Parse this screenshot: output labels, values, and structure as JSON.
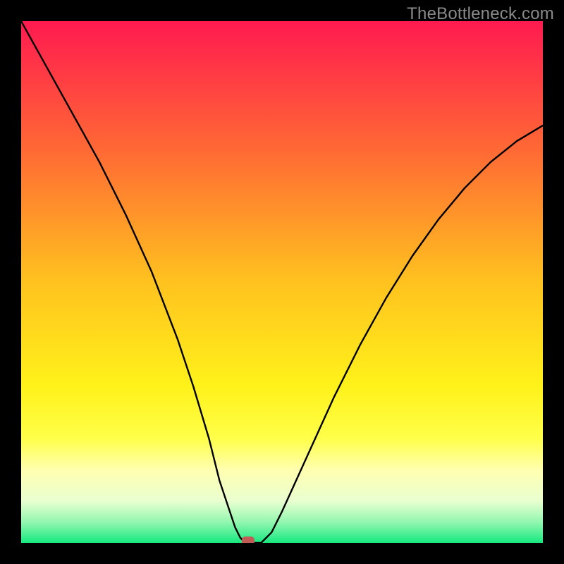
{
  "watermark": "TheBottleneck.com",
  "chart_data": {
    "type": "line",
    "title": "",
    "xlabel": "",
    "ylabel": "",
    "xlim": [
      0,
      100
    ],
    "ylim": [
      0,
      100
    ],
    "grid": false,
    "legend": false,
    "series": [
      {
        "name": "curve",
        "color": "#000000",
        "x": [
          0,
          5,
          10,
          15,
          20,
          25,
          30,
          33,
          36,
          38,
          40,
          41,
          42,
          43,
          44,
          46,
          48,
          50,
          55,
          60,
          65,
          70,
          75,
          80,
          85,
          90,
          95,
          100
        ],
        "values": [
          100,
          91,
          82,
          73,
          63,
          52,
          39,
          30,
          20,
          12,
          6,
          3,
          1,
          0,
          0,
          0,
          2,
          6,
          17,
          28,
          38,
          47,
          55,
          62,
          68,
          73,
          77,
          80
        ]
      }
    ],
    "background_gradient": {
      "direction": "vertical",
      "stops": [
        {
          "offset": 0.0,
          "color": "#ff1a50"
        },
        {
          "offset": 0.25,
          "color": "#ff6a34"
        },
        {
          "offset": 0.5,
          "color": "#ffc21f"
        },
        {
          "offset": 0.7,
          "color": "#fff21a"
        },
        {
          "offset": 0.8,
          "color": "#ffff4a"
        },
        {
          "offset": 0.86,
          "color": "#ffffb0"
        },
        {
          "offset": 0.92,
          "color": "#e9ffd0"
        },
        {
          "offset": 0.96,
          "color": "#93f7b0"
        },
        {
          "offset": 1.0,
          "color": "#17e880"
        }
      ]
    },
    "marker": {
      "x": 43.5,
      "y": 0.4,
      "color": "#c25a55",
      "shape": "rounded-rect"
    }
  }
}
